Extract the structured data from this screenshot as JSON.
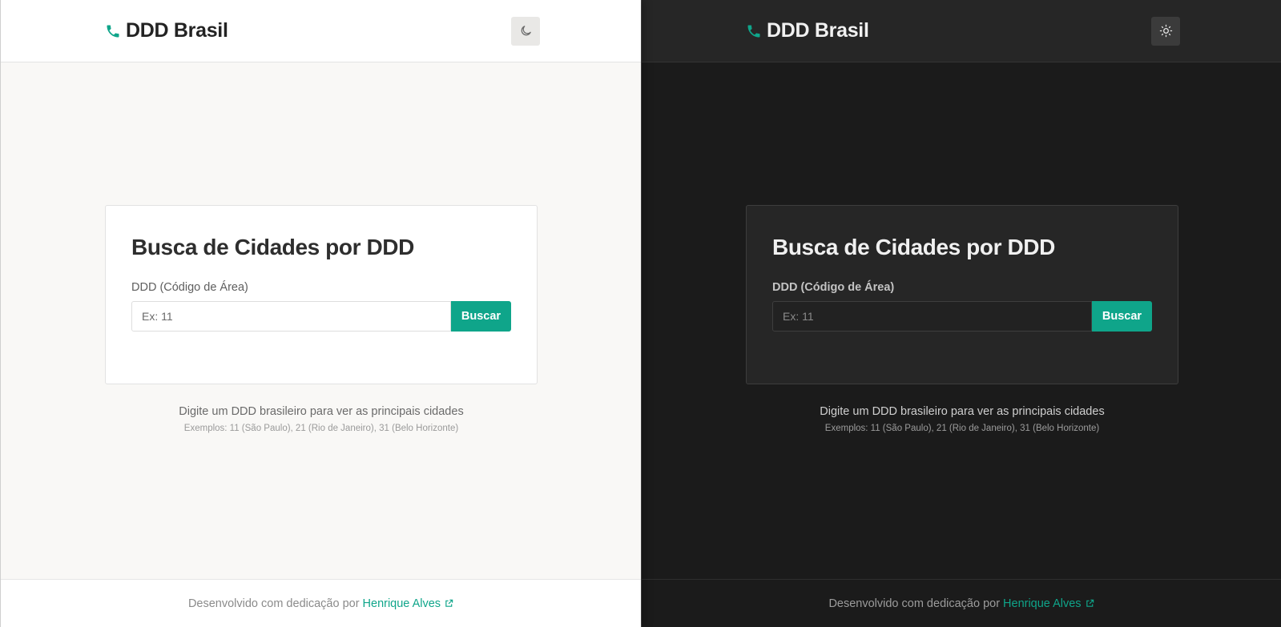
{
  "brand": {
    "name": "DDD Brasil",
    "icon": "phone-icon",
    "accent": "#0fa58a"
  },
  "light_theme": {
    "toggle_icon": "moon-icon",
    "background": "#f9f8f6"
  },
  "dark_theme": {
    "toggle_icon": "sun-icon",
    "background": "#1b1b1b"
  },
  "card": {
    "title": "Busca de Cidades por DDD",
    "field_label": "DDD (Código de Área)",
    "input_placeholder": "Ex: 11",
    "input_value": "",
    "button_label": "Buscar"
  },
  "hint": {
    "main": "Digite um DDD brasileiro para ver as principais cidades",
    "examples": "Exemplos: 11 (São Paulo), 21 (Rio de Janeiro), 31 (Belo Horizonte)"
  },
  "footer": {
    "prefix": "Desenvolvido com dedicação por",
    "author": "Henrique Alves",
    "link_icon": "external-link-icon"
  }
}
